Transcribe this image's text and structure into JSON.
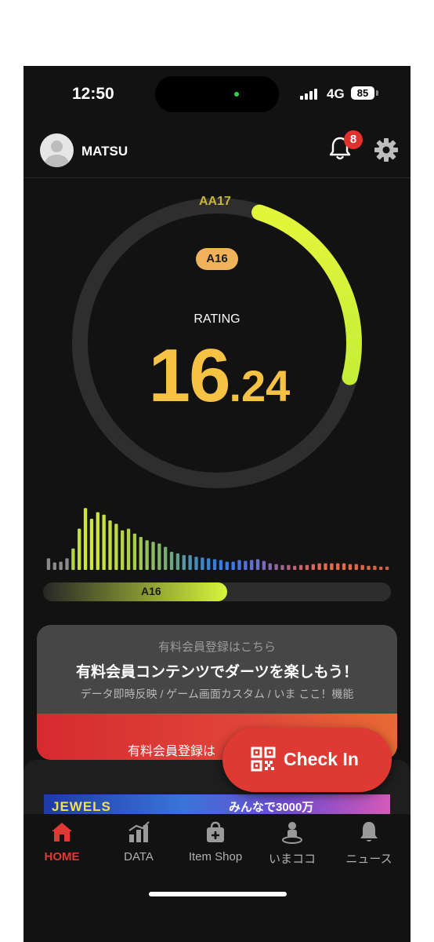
{
  "status_bar": {
    "time": "12:50",
    "network": "4G",
    "battery": "85"
  },
  "header": {
    "username": "MATSU",
    "notification_count": "8"
  },
  "rating": {
    "top_grade": "AA17",
    "current_grade": "A16",
    "label": "RATING",
    "value_int": "16",
    "value_dec": ".24",
    "progress_to_next": 0.24
  },
  "histogram": {
    "values": [
      14,
      9,
      10,
      14,
      26,
      50,
      75,
      62,
      70,
      67,
      60,
      56,
      48,
      50,
      44,
      40,
      36,
      34,
      32,
      28,
      22,
      20,
      18,
      18,
      16,
      15,
      14,
      13,
      12,
      10,
      10,
      12,
      11,
      12,
      13,
      11,
      8,
      7,
      6,
      6,
      5,
      6,
      6,
      7,
      8,
      8,
      8,
      8,
      8,
      7,
      7,
      6,
      5,
      5,
      4,
      4
    ],
    "colors": [
      "#8a8a8a",
      "#8a8a8a",
      "#8a8a8a",
      "#8a8a8a",
      "#b2d44a",
      "#c2e044",
      "#cde443",
      "#cde443",
      "#cde443",
      "#c9e143",
      "#c3dd44",
      "#bed946",
      "#b7d548",
      "#b1d14a",
      "#a9cc4d",
      "#a0c753",
      "#97c159",
      "#8dba60",
      "#84b46a",
      "#79ad74",
      "#6ea77f",
      "#63a089",
      "#5898a0",
      "#4f91ad",
      "#478bba",
      "#4284c6",
      "#3d7fd0",
      "#3b7bd8",
      "#3a7ade",
      "#3c79e0",
      "#3f78e2",
      "#4a76df",
      "#5573db",
      "#6270d4",
      "#6d6ec8",
      "#7a6bbd",
      "#8868b0",
      "#9666a2",
      "#a36494",
      "#b06387",
      "#bd637a",
      "#c8636e",
      "#d26563",
      "#d9675a",
      "#de6a52",
      "#e16c4c",
      "#e26c47",
      "#e36c44",
      "#e36b42",
      "#e26a42",
      "#e16842",
      "#df6643",
      "#dd6444",
      "#db6245",
      "#d86046",
      "#d55e47"
    ]
  },
  "level_bar": {
    "label": "A16",
    "fill": 0.53
  },
  "promo": {
    "subtitle": "有料会員登録はこちら",
    "title": "有料会員コンテンツでダーツを楽しもう！",
    "features": "データ即時反映 / ゲーム画面カスタム / いま ここ！機能",
    "button_label": "有料会員登録は"
  },
  "banner": {
    "left_text": "JEWELS",
    "right_text": "みんなで3000万"
  },
  "check_in": {
    "label": "Check In"
  },
  "tabs": [
    {
      "label": "HOME",
      "icon": "home-icon",
      "active": true
    },
    {
      "label": "DATA",
      "icon": "chart-icon",
      "active": false
    },
    {
      "label": "Item Shop",
      "icon": "shop-bag-icon",
      "active": false
    },
    {
      "label": "いまココ",
      "icon": "location-person-icon",
      "active": false
    },
    {
      "label": "ニュース",
      "icon": "bell-icon",
      "active": false
    }
  ],
  "colors": {
    "accent": "#de3a33",
    "gauge_start": "#e3f53a",
    "gauge_end": "#c8ef3a",
    "rating_gold": "#f6c243"
  }
}
